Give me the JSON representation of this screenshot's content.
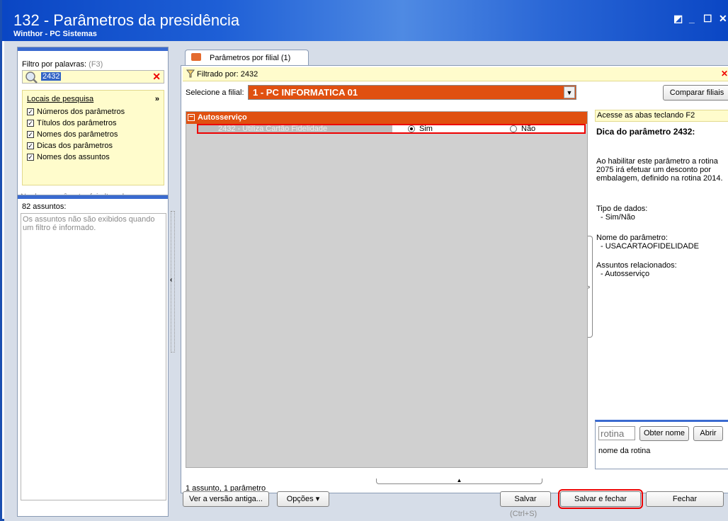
{
  "window": {
    "title": "132 - Parâmetros da presidência",
    "subtitle": "Winthor - PC Sistemas",
    "controls": [
      "◩",
      "_",
      "☐",
      "✕"
    ]
  },
  "filter": {
    "label": "Filtro por palavras:",
    "shortcut": "(F3)",
    "value": "2432"
  },
  "search_places": {
    "title": "Locais de pesquisa",
    "options": [
      {
        "label": "Números dos parâmetros",
        "checked": true
      },
      {
        "label": "Títulos dos parâmetros",
        "checked": true
      },
      {
        "label": "Nomes dos parâmetros",
        "checked": true
      },
      {
        "label": "Dicas dos parâmetros",
        "checked": true
      },
      {
        "label": "Nomes dos assuntos",
        "checked": true
      }
    ],
    "status": "Nenhum parâmetro foi alterado."
  },
  "subjects": {
    "count_label": "82 assuntos:",
    "note": "Os assuntos não são exibidos quando um filtro é informado."
  },
  "tab": {
    "label": "Parâmetros por filial  (1)"
  },
  "filter_bar": {
    "text": "Filtrado por: 2432"
  },
  "branch": {
    "label": "Selecione a filial:",
    "value": "1 - PC INFORMATICA 01",
    "compare_button": "Comparar filiais"
  },
  "grid": {
    "group": "Autosserviço",
    "param": {
      "name": "2432 - Utiliza Cartão Fidelidade",
      "opt_yes": "Sim",
      "opt_no": "Não",
      "selected": "Sim"
    },
    "summary": "1 assunto, 1 parâmetro"
  },
  "tip": {
    "hint": "Acesse as abas teclando F2",
    "title": "Dica do parâmetro 2432:",
    "description": "Ao habilitar este parâmetro a rotina 2075 irá efetuar um desconto por embalagem, definido na rotina 2014.",
    "data_type_label": "Tipo de dados:",
    "data_type_value": "- Sim/Não",
    "param_name_label": "Nome do parâmetro:",
    "param_name_value": "- USACARTAOFIDELIDADE",
    "related_label": "Assuntos relacionados:",
    "related_value": "- Autosserviço"
  },
  "routine": {
    "placeholder": "rotina",
    "get_name_button": "Obter nome",
    "open_button": "Abrir",
    "name_text": "nome da rotina"
  },
  "footer": {
    "old_version_button": "Ver a versão antiga...",
    "options_button": "Opções ▾",
    "save_button": "Salvar",
    "save_shortcut": "(Ctrl+S)",
    "save_close_button": "Salvar e fechar",
    "close_button": "Fechar"
  }
}
